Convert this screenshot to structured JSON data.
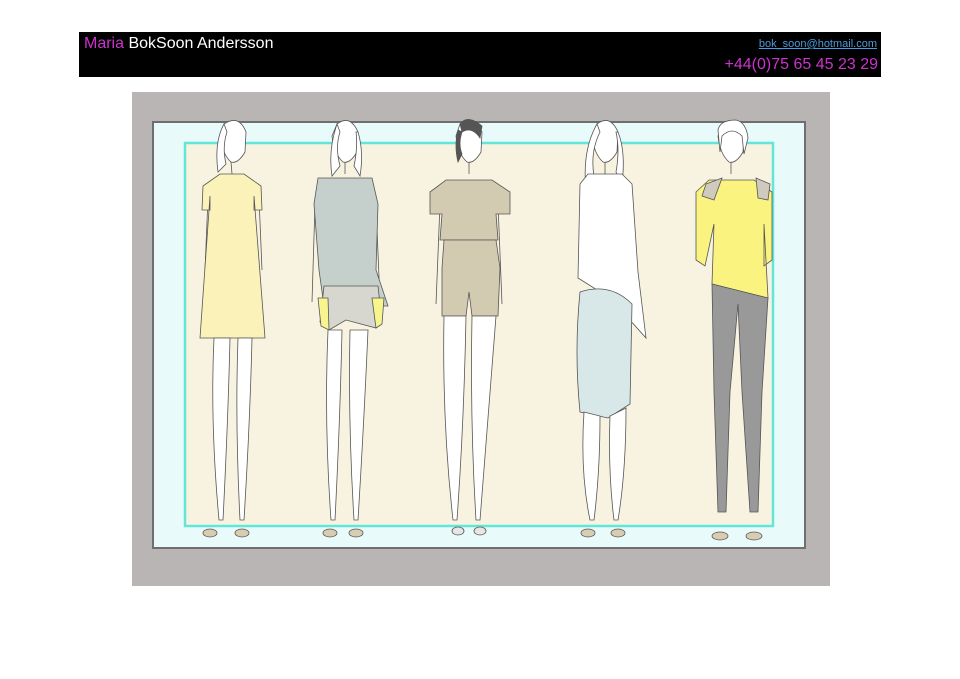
{
  "header": {
    "first_name": "Maria",
    "last_name": "BokSoon Andersson",
    "email": "bok_soon@hotmail.com",
    "phone": "+44(0)75 65 45 23 29"
  },
  "colors": {
    "header_bg": "#000000",
    "accent_magenta": "#cc33cc",
    "link_blue": "#4a9be0",
    "frame_grey": "#bab5b5",
    "panel_cyan": "#e8fbfa",
    "cyan_border": "#63e6d8",
    "sheet_cream": "#f8f3e1"
  },
  "figures": [
    {
      "id": "yellow-shift-dress",
      "garment_color": "#fbf2b9"
    },
    {
      "id": "grey-top-shorts",
      "garment_color": "#c5d0cc"
    },
    {
      "id": "khaki-playsuit",
      "garment_color": "#d3cab2"
    },
    {
      "id": "white-shirt-blue-skirt",
      "garment_color": "#d8e8e8"
    },
    {
      "id": "yellow-top-grey-leggings",
      "garment_color": "#fbf37f"
    }
  ]
}
